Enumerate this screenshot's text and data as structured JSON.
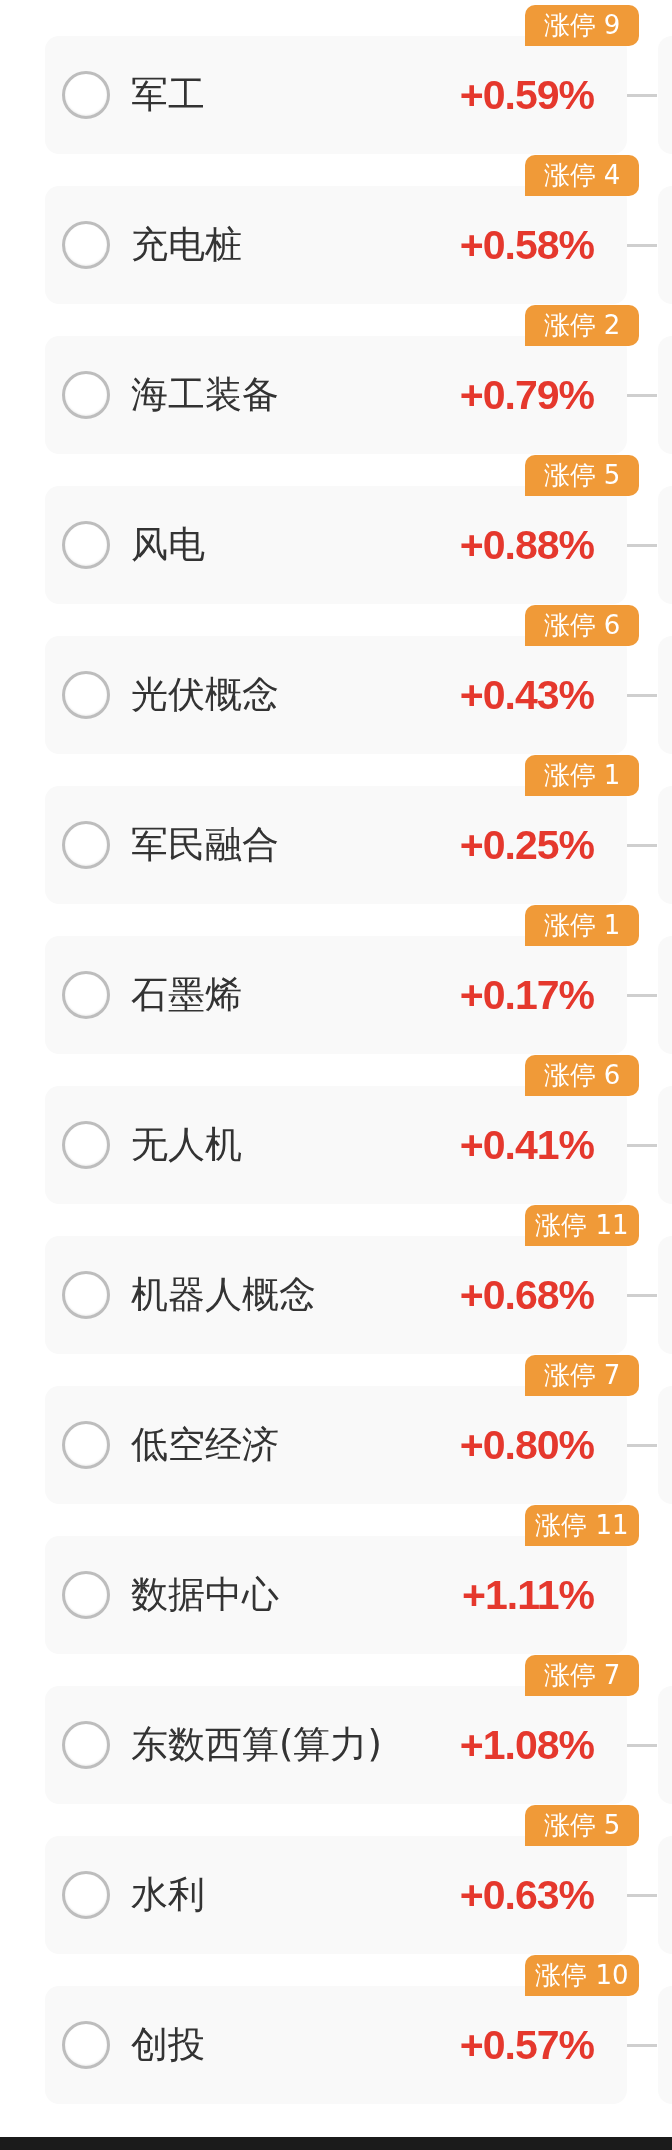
{
  "items": [
    {
      "name": "军工",
      "change": "+0.59%",
      "limit_up": "涨停 9",
      "selected": false,
      "has_side_card": true
    },
    {
      "name": "充电桩",
      "change": "+0.58%",
      "limit_up": "涨停 4",
      "selected": false,
      "has_side_card": true
    },
    {
      "name": "海工装备",
      "change": "+0.79%",
      "limit_up": "涨停 2",
      "selected": false,
      "has_side_card": true
    },
    {
      "name": "风电",
      "change": "+0.88%",
      "limit_up": "涨停 5",
      "selected": false,
      "has_side_card": true
    },
    {
      "name": "光伏概念",
      "change": "+0.43%",
      "limit_up": "涨停 6",
      "selected": false,
      "has_side_card": true
    },
    {
      "name": "军民融合",
      "change": "+0.25%",
      "limit_up": "涨停 1",
      "selected": false,
      "has_side_card": true
    },
    {
      "name": "石墨烯",
      "change": "+0.17%",
      "limit_up": "涨停 1",
      "selected": false,
      "has_side_card": true
    },
    {
      "name": "无人机",
      "change": "+0.41%",
      "limit_up": "涨停 6",
      "selected": false,
      "has_side_card": true
    },
    {
      "name": "机器人概念",
      "change": "+0.68%",
      "limit_up": "涨停 11",
      "selected": false,
      "has_side_card": true
    },
    {
      "name": "低空经济",
      "change": "+0.80%",
      "limit_up": "涨停 7",
      "selected": false,
      "has_side_card": true
    },
    {
      "name": "数据中心",
      "change": "+1.11%",
      "limit_up": "涨停 11",
      "selected": false,
      "has_side_card": false
    },
    {
      "name": "东数西算(算力)",
      "change": "+1.08%",
      "limit_up": "涨停 7",
      "selected": false,
      "has_side_card": true
    },
    {
      "name": "水利",
      "change": "+0.63%",
      "limit_up": "涨停 5",
      "selected": false,
      "has_side_card": true
    },
    {
      "name": "创投",
      "change": "+0.57%",
      "limit_up": "涨停 10",
      "selected": false,
      "has_side_card": true
    }
  ]
}
